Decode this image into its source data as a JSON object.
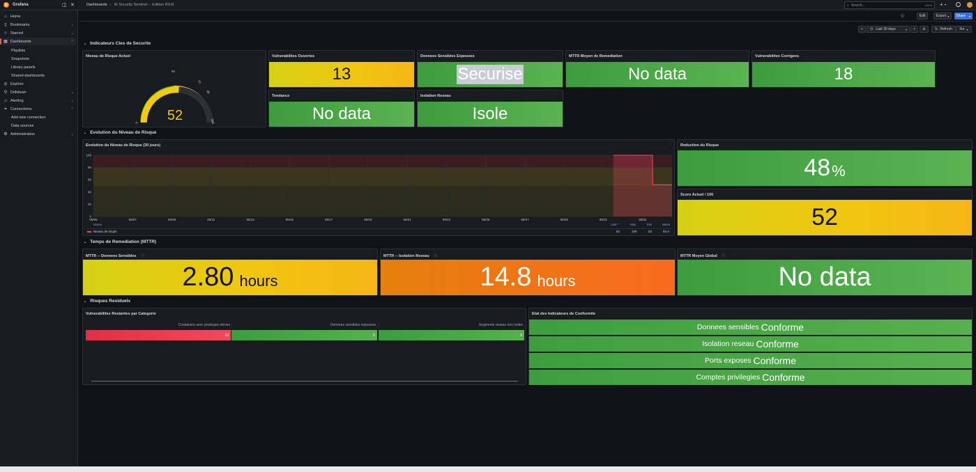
{
  "app": {
    "name": "Grafana"
  },
  "breadcrumb": {
    "root": "Dashboards",
    "sep": "›",
    "current": "AI Security Sentinel -- Edition RSSI"
  },
  "search": {
    "placeholder": "Search...",
    "shortcut": "ctrl+k"
  },
  "sidebar": {
    "items": [
      {
        "label": "Home",
        "icon": "home-icon"
      },
      {
        "label": "Bookmarks",
        "icon": "bookmark-icon"
      },
      {
        "label": "Starred",
        "icon": "star-icon"
      },
      {
        "label": "Dashboards",
        "icon": "dashboards-icon"
      },
      {
        "label": "Playlists"
      },
      {
        "label": "Snapshots"
      },
      {
        "label": "Library panels"
      },
      {
        "label": "Shared dashboards"
      },
      {
        "label": "Explore",
        "icon": "compass-icon"
      },
      {
        "label": "Drilldown",
        "icon": "drilldown-icon"
      },
      {
        "label": "Alerting",
        "icon": "bell-icon"
      },
      {
        "label": "Connections",
        "icon": "plug-icon"
      },
      {
        "label": "Add new connection"
      },
      {
        "label": "Data sources"
      },
      {
        "label": "Administration",
        "icon": "gear-icon"
      }
    ]
  },
  "toolbar": {
    "edit": "Edit",
    "export": "Export",
    "share": "Share",
    "time_range": "Last 30 days",
    "refresh": "Refresh",
    "interval": "5m"
  },
  "rows": {
    "r1": "Indicateurs Cles de Securite",
    "r2": "Evolution du Niveau de Risque",
    "r3": "Temps de Remediation (MTTR)",
    "r4": "Risques Residuels"
  },
  "panels": {
    "gauge": {
      "title": "Niveau de Risque Actuel",
      "value": "52",
      "ticks": [
        "0",
        "50",
        "70",
        "80",
        "100"
      ],
      "value_num": 52,
      "max": 100
    },
    "vuln_open": {
      "title": "Vulnerabilites Ouvertes",
      "value": "13"
    },
    "sensitive": {
      "title": "Donnees Sensibles Exposees",
      "value": "Securise"
    },
    "mttr_mean": {
      "title": "MTTR Moyen de Remediation",
      "value": "No data"
    },
    "vuln_fixed": {
      "title": "Vulnerabilites Corrigees",
      "value": "18"
    },
    "trend": {
      "title": "Tendance",
      "value": "No data"
    },
    "isolation": {
      "title": "Isolation Reseau",
      "value": "Isole"
    },
    "timeseries": {
      "title": "Evolution du Niveau de Risque (30 jours)"
    },
    "reduction": {
      "title": "Reduction du Risque",
      "value": "48",
      "unit": "%"
    },
    "score": {
      "title": "Score Actuel / 100",
      "value": "52"
    },
    "mttr_data": {
      "title": "MTTR -- Donnees Sensibles",
      "value": "2.80",
      "unit": "hours",
      "info": "ⓘ"
    },
    "mttr_iso": {
      "title": "MTTR -- Isolation Reseau",
      "value": "14.8",
      "unit": "hours",
      "info": "ⓘ"
    },
    "mttr_global": {
      "title": "MTTR Moyen Global",
      "value": "No data",
      "info": "ⓘ"
    },
    "residual": {
      "title": "Vulnerabilites Restantes par Categorie",
      "columns": [
        "Containers avec privileges eleves",
        "Donnees sensibles exposees",
        "Segments reseau non isoles"
      ],
      "values": [
        "13",
        "0",
        "0"
      ]
    },
    "compliance": {
      "title": "Etat des Indicateurs de Conformite",
      "rows": [
        {
          "label": "Donnees sensibles",
          "status": "Conforme"
        },
        {
          "label": "Isolation reseau",
          "status": "Conforme"
        },
        {
          "label": "Ports exposes",
          "status": "Conforme"
        },
        {
          "label": "Comptes privilegies",
          "status": "Conforme"
        }
      ]
    }
  },
  "legend": {
    "headers": [
      "Name",
      "Last *",
      "Max",
      "Min",
      "Mean"
    ],
    "series": "Niveau de risque",
    "values": [
      "52",
      "100",
      "52",
      "83.4"
    ]
  },
  "chart_data": {
    "type": "line",
    "x": [
      "05/05",
      "05/07",
      "05/09",
      "05/11",
      "05/13",
      "05/15",
      "05/17",
      "05/19",
      "05/21",
      "05/23",
      "05/25",
      "05/27",
      "05/29",
      "05/31",
      "06/02"
    ],
    "series": [
      {
        "name": "Niveau de risque",
        "points": [
          [
            "05/31 12:00",
            100
          ],
          [
            "06/02 12:00",
            100
          ],
          [
            "06/02 12:30",
            52
          ],
          [
            "06/03 12:00",
            52
          ]
        ]
      }
    ],
    "ylim": [
      0,
      100
    ],
    "yticks": [
      "0",
      "20",
      "40",
      "60",
      "80",
      "100"
    ],
    "thresholds": [
      {
        "from": 0,
        "to": 50,
        "color": "#3d3a1e"
      },
      {
        "from": 50,
        "to": 80,
        "color": "#5a4a17"
      },
      {
        "from": 80,
        "to": 100,
        "color": "#5c1e22"
      }
    ],
    "colors": {
      "series": "#f2495c"
    }
  }
}
